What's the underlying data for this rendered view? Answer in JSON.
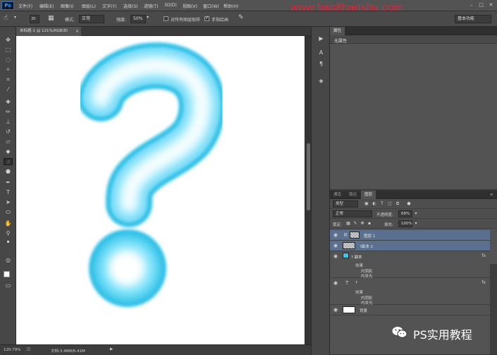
{
  "app": {
    "logo": "Ps"
  },
  "menu": [
    "文件(F)",
    "编辑(E)",
    "图像(I)",
    "图层(L)",
    "文字(Y)",
    "选择(S)",
    "滤镜(T)",
    "3D(D)",
    "视图(V)",
    "窗口(W)",
    "帮助(H)"
  ],
  "watermark": "www.hao8hanshu.com",
  "options": {
    "brush_size": "35",
    "mode_label": "模式:",
    "mode_value": "正常",
    "strength_label": "强度:",
    "strength_value": "50%",
    "sample_all_label": "对所有图层取样",
    "finger_paint_label": "手指绘画",
    "workspace": "基本功能"
  },
  "document": {
    "tab_label": "未标题-1 @ 121%(RGB/8)",
    "close": "×",
    "zoom": "120.79%",
    "doc_size": "文档:3.48M/6.41M"
  },
  "colors": {
    "canvas": "#ffffff",
    "shape_core": "#ffffff",
    "shape_mid": "#8fe8fb",
    "shape_edge": "#2bbfe6",
    "selected_layer": "#5b6f8e"
  },
  "properties": {
    "tab": "属性",
    "empty_text": "无属性"
  },
  "layers_panel": {
    "tabs": [
      "通道",
      "路径",
      "图层"
    ],
    "kind_filter": "类型",
    "blend_mode": "正常",
    "opacity_label": "不透明度:",
    "opacity_value": "68%",
    "lock_label": "锁定:",
    "fill_label": "填充:",
    "fill_value": "100%",
    "layers": [
      {
        "name": "图层 1",
        "selected": true
      },
      {
        "name": "?副本 2",
        "selected": true
      },
      {
        "name": "? 副本",
        "selected": false,
        "fx": "fx",
        "effects_label": "效果",
        "effects": [
          "内阴影",
          "内发光"
        ]
      },
      {
        "name": "?",
        "selected": false,
        "fx": "fx",
        "effects_label": "效果",
        "effects": [
          "内阴影",
          "内发光"
        ]
      },
      {
        "name": "背景",
        "selected": false
      }
    ]
  },
  "branding": {
    "text": "PS实用教程"
  }
}
